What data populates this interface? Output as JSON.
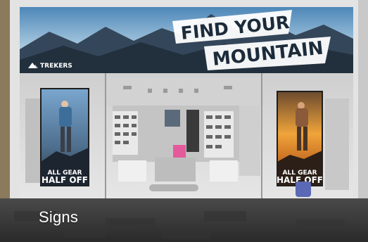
{
  "banner": {
    "line1": "FIND YOUR",
    "line2": "MOUNTAIN",
    "brand": "TREKERS"
  },
  "posters": {
    "left": {
      "line1": "ALL GEAR",
      "line2": "HALF OFF"
    },
    "right": {
      "line1": "ALL GEAR",
      "line2": "HALF OFF"
    }
  },
  "caption": "Signs",
  "colors": {
    "banner_sky": "#6fa3c9",
    "banner_text": "#1c2b3a",
    "store_wall": "#d8d8d8",
    "floor": "#3a3a3a"
  }
}
